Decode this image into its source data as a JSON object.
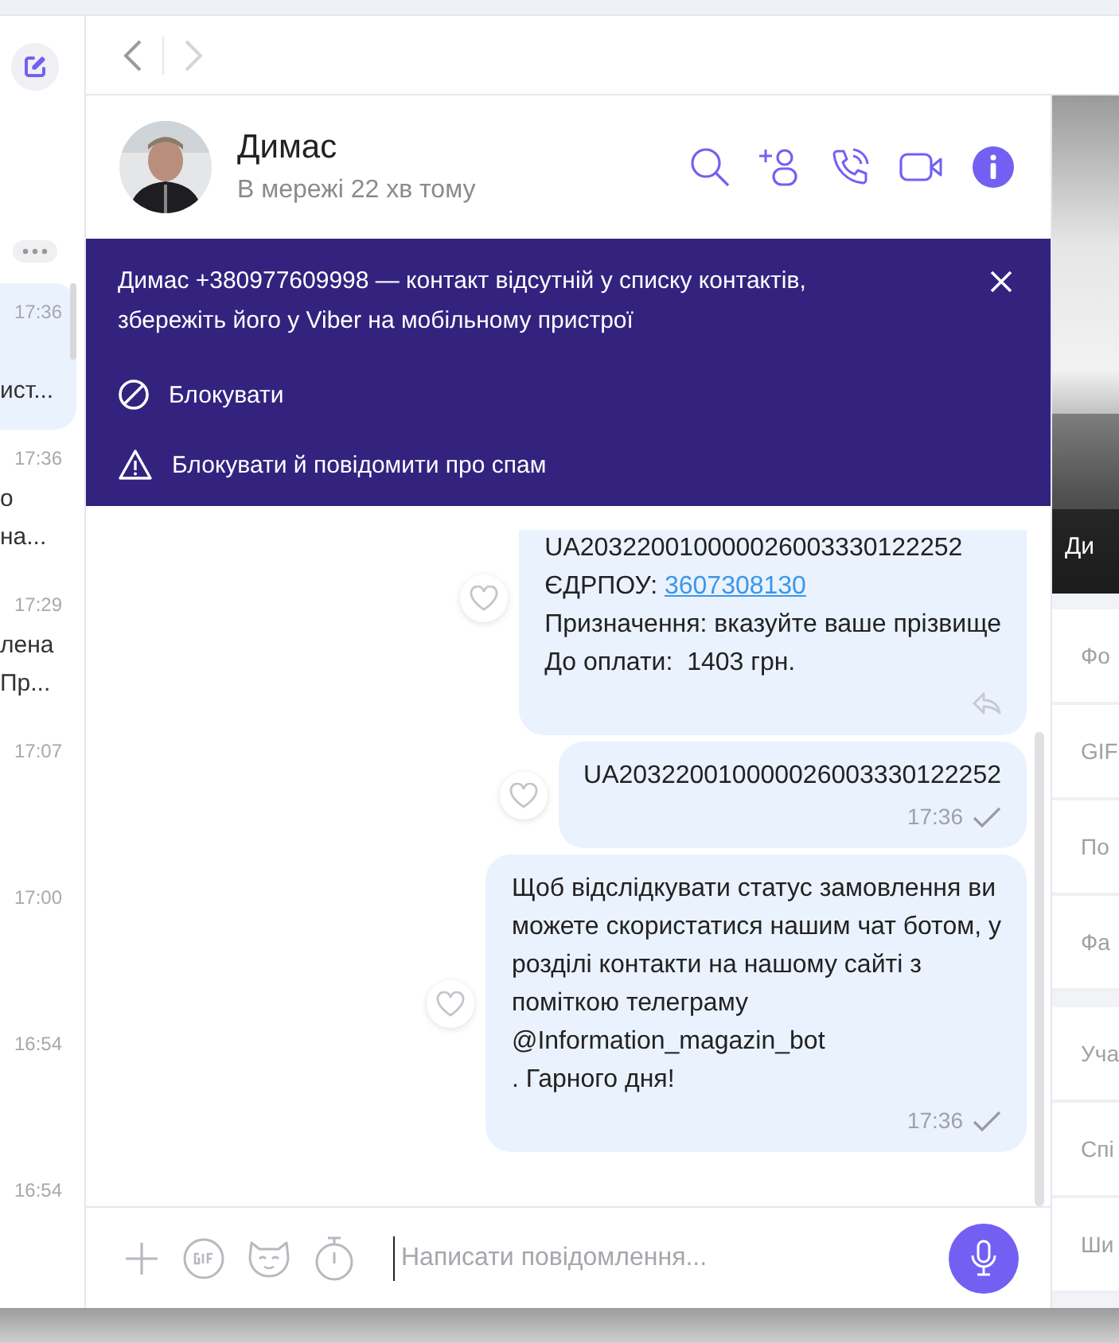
{
  "navigation": {
    "back_enabled": true,
    "forward_enabled": false
  },
  "sidebar": {
    "chats": [
      {
        "time": "17:36",
        "lines": [
          "ист..."
        ],
        "selected": true
      },
      {
        "time": "17:36",
        "lines": [
          "о",
          "на..."
        ],
        "selected": false
      },
      {
        "time": "17:29",
        "lines": [
          "лена",
          "Пр..."
        ],
        "selected": false
      },
      {
        "time": "17:07",
        "selected": false
      },
      {
        "time": "17:00",
        "selected": false
      },
      {
        "time": "16:54",
        "selected": false
      },
      {
        "time": "16:54",
        "selected": false
      }
    ]
  },
  "chat": {
    "name": "Димас",
    "status": "В мережі 22 хв тому"
  },
  "banner": {
    "message": "Димас +380977609998 — контакт відсутній у списку контактів, збережіть його у Viber на мобільному пристрої",
    "actions": [
      {
        "kind": "block",
        "label": "Блокувати"
      },
      {
        "kind": "report",
        "label": "Блокувати й повідомити про спам"
      }
    ]
  },
  "messages": [
    {
      "parts": [
        {
          "kind": "text",
          "text": "UA203220010000026003330122252\nЄДРПОУ: "
        },
        {
          "kind": "link",
          "text": "3607308130"
        },
        {
          "kind": "text",
          "text": "\nПризначення: вказуйте ваше прізвище\nДо оплати:  1403 грн."
        }
      ],
      "delivered": false,
      "shareable": true
    },
    {
      "parts": [
        {
          "kind": "text",
          "text": "UA203220010000026003330122252"
        }
      ],
      "time": "17:36",
      "delivered": true,
      "shareable": false
    },
    {
      "parts": [
        {
          "kind": "text",
          "text": "Щоб відслідкувати статус замовлення ви\nможете скористатися нашим чат ботом, у\nрозділі контакти на нашому сайті з\nпоміткою телеграму\n@Information_magazin_bot\n. Гарного дня!"
        }
      ],
      "time": "17:36",
      "delivered": true,
      "shareable": false
    }
  ],
  "composer": {
    "placeholder": "Написати повідомлення..."
  },
  "info_panel": {
    "photo_caption": "Ди",
    "groups": [
      [
        "Фо",
        "GIF",
        "По",
        "Фа"
      ],
      [
        "Уча",
        "Спі",
        "Ши"
      ]
    ]
  }
}
